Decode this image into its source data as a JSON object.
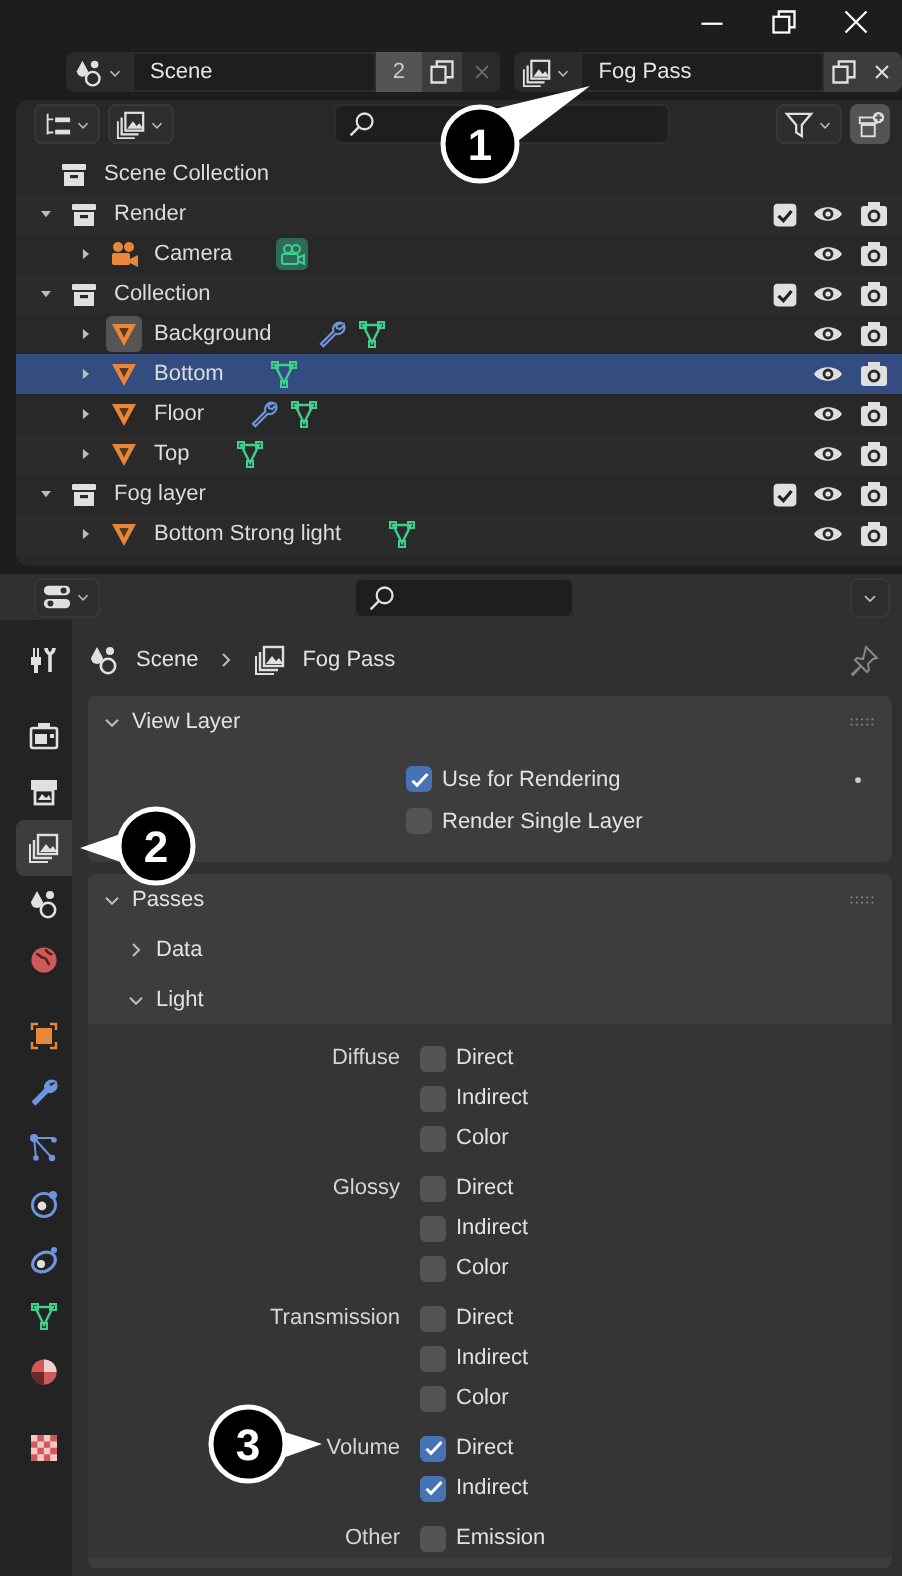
{
  "scene_selector": {
    "name": "Scene",
    "users": "2"
  },
  "view_layer_selector": {
    "name": "Fog Pass"
  },
  "outliner": {
    "tree": [
      {
        "label": "Scene Collection",
        "kind": "scene_collection",
        "children": [
          {
            "label": "Render",
            "kind": "collection",
            "expanded": true,
            "checked": true,
            "selected": false,
            "active": false,
            "children": [
              {
                "label": "Camera",
                "kind": "camera",
                "expanded": false,
                "selected": false,
                "active": false,
                "data_icons": [
                  {
                    "kind": "camera_data"
                  }
                ]
              }
            ]
          },
          {
            "label": "Collection",
            "kind": "collection",
            "expanded": true,
            "checked": true,
            "selected": false,
            "active": false,
            "children": [
              {
                "label": "Background",
                "kind": "mesh",
                "expanded": false,
                "selected": false,
                "active": true,
                "data_icons": [
                  {
                    "kind": "modifier"
                  },
                  {
                    "kind": "mesh_data"
                  }
                ]
              },
              {
                "label": "Bottom",
                "kind": "mesh",
                "expanded": false,
                "selected": true,
                "active": false,
                "data_icons": [
                  {
                    "kind": "mesh_data"
                  }
                ]
              },
              {
                "label": "Floor",
                "kind": "mesh",
                "expanded": false,
                "selected": false,
                "active": false,
                "data_icons": [
                  {
                    "kind": "modifier"
                  },
                  {
                    "kind": "mesh_data"
                  }
                ]
              },
              {
                "label": "Top",
                "kind": "mesh",
                "expanded": false,
                "selected": false,
                "active": false,
                "data_icons": [
                  {
                    "kind": "mesh_data"
                  }
                ]
              }
            ]
          },
          {
            "label": "Fog layer",
            "kind": "collection",
            "expanded": true,
            "checked": true,
            "selected": false,
            "active": false,
            "children": [
              {
                "label": "Bottom Strong light",
                "kind": "mesh",
                "expanded": false,
                "selected": false,
                "active": false,
                "data_icons": [
                  {
                    "kind": "mesh_data"
                  }
                ]
              }
            ]
          }
        ]
      }
    ]
  },
  "properties": {
    "breadcrumb": [
      "Scene",
      "Fog Pass"
    ],
    "tab_groups": [
      [
        {
          "kind": "tool",
          "selected": false
        }
      ],
      [
        {
          "kind": "render",
          "selected": false
        },
        {
          "kind": "output",
          "selected": false
        },
        {
          "kind": "view_layer",
          "selected": true
        },
        {
          "kind": "scene",
          "selected": false
        },
        {
          "kind": "world",
          "selected": false
        }
      ],
      [
        {
          "kind": "object",
          "selected": false
        },
        {
          "kind": "modifier",
          "selected": false
        },
        {
          "kind": "particles",
          "selected": false
        },
        {
          "kind": "physics",
          "selected": false
        },
        {
          "kind": "constraints",
          "selected": false
        },
        {
          "kind": "data",
          "selected": false
        },
        {
          "kind": "material",
          "selected": false
        }
      ],
      [
        {
          "kind": "texture",
          "selected": false
        }
      ]
    ],
    "panels": [
      {
        "title": "View Layer",
        "expanded": true,
        "options": [
          {
            "label": "Use for Rendering",
            "checked": true
          },
          {
            "label": "Render Single Layer",
            "checked": false
          }
        ]
      },
      {
        "title": "Passes",
        "expanded": true,
        "subpanels": [
          {
            "title": "Data",
            "expanded": false
          },
          {
            "title": "Light",
            "expanded": true,
            "groups": [
              {
                "label": "Diffuse",
                "options": [
                  {
                    "label": "Direct",
                    "checked": false
                  },
                  {
                    "label": "Indirect",
                    "checked": false
                  },
                  {
                    "label": "Color",
                    "checked": false
                  }
                ]
              },
              {
                "label": "Glossy",
                "options": [
                  {
                    "label": "Direct",
                    "checked": false
                  },
                  {
                    "label": "Indirect",
                    "checked": false
                  },
                  {
                    "label": "Color",
                    "checked": false
                  }
                ]
              },
              {
                "label": "Transmission",
                "options": [
                  {
                    "label": "Direct",
                    "checked": false
                  },
                  {
                    "label": "Indirect",
                    "checked": false
                  },
                  {
                    "label": "Color",
                    "checked": false
                  }
                ]
              },
              {
                "label": "Volume",
                "options": [
                  {
                    "label": "Direct",
                    "checked": true
                  },
                  {
                    "label": "Indirect",
                    "checked": true
                  }
                ]
              },
              {
                "label": "Other",
                "options": [
                  {
                    "label": "Emission",
                    "checked": false
                  }
                ]
              }
            ]
          }
        ]
      }
    ]
  },
  "callouts": [
    "1",
    "2",
    "3"
  ]
}
